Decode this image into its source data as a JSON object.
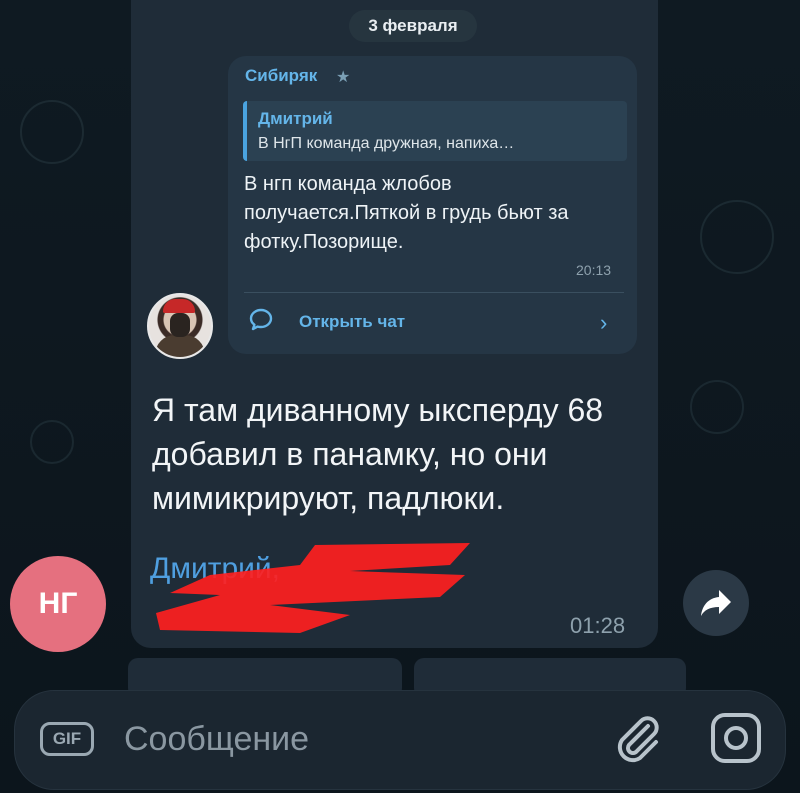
{
  "date_separator": "3 февраля",
  "forwarded_post": {
    "sender": "Сибиряк",
    "reply": {
      "name": "Дмитрий",
      "text": "В НгП команда дружная, напиха…"
    },
    "text": "В нгп команда жлобов получается.Пяткой в грудь бьют за фотку.Позорище.",
    "time": "20:13",
    "open_chat_label": "Открыть чат"
  },
  "message": {
    "text": "Я там диванному ыксперду 68 добавил в панамку, но они мимикрируют, падлюки.",
    "mention": "Дмитрий,",
    "time": "01:28"
  },
  "author_avatar_initials": "НГ",
  "composer": {
    "gif_label": "GIF",
    "placeholder": "Сообщение"
  },
  "icons": {
    "star": "star-icon",
    "open_chat": "chat-bubble-icon",
    "chevron": "chevron-right-icon",
    "share": "share-arrow-icon",
    "attach": "paperclip-icon",
    "camera": "camera-icon"
  },
  "colors": {
    "accent": "#64b5e9",
    "avatar_bg": "#e5707f",
    "bubble": "#1f2c38",
    "redaction": "#ff2020"
  }
}
